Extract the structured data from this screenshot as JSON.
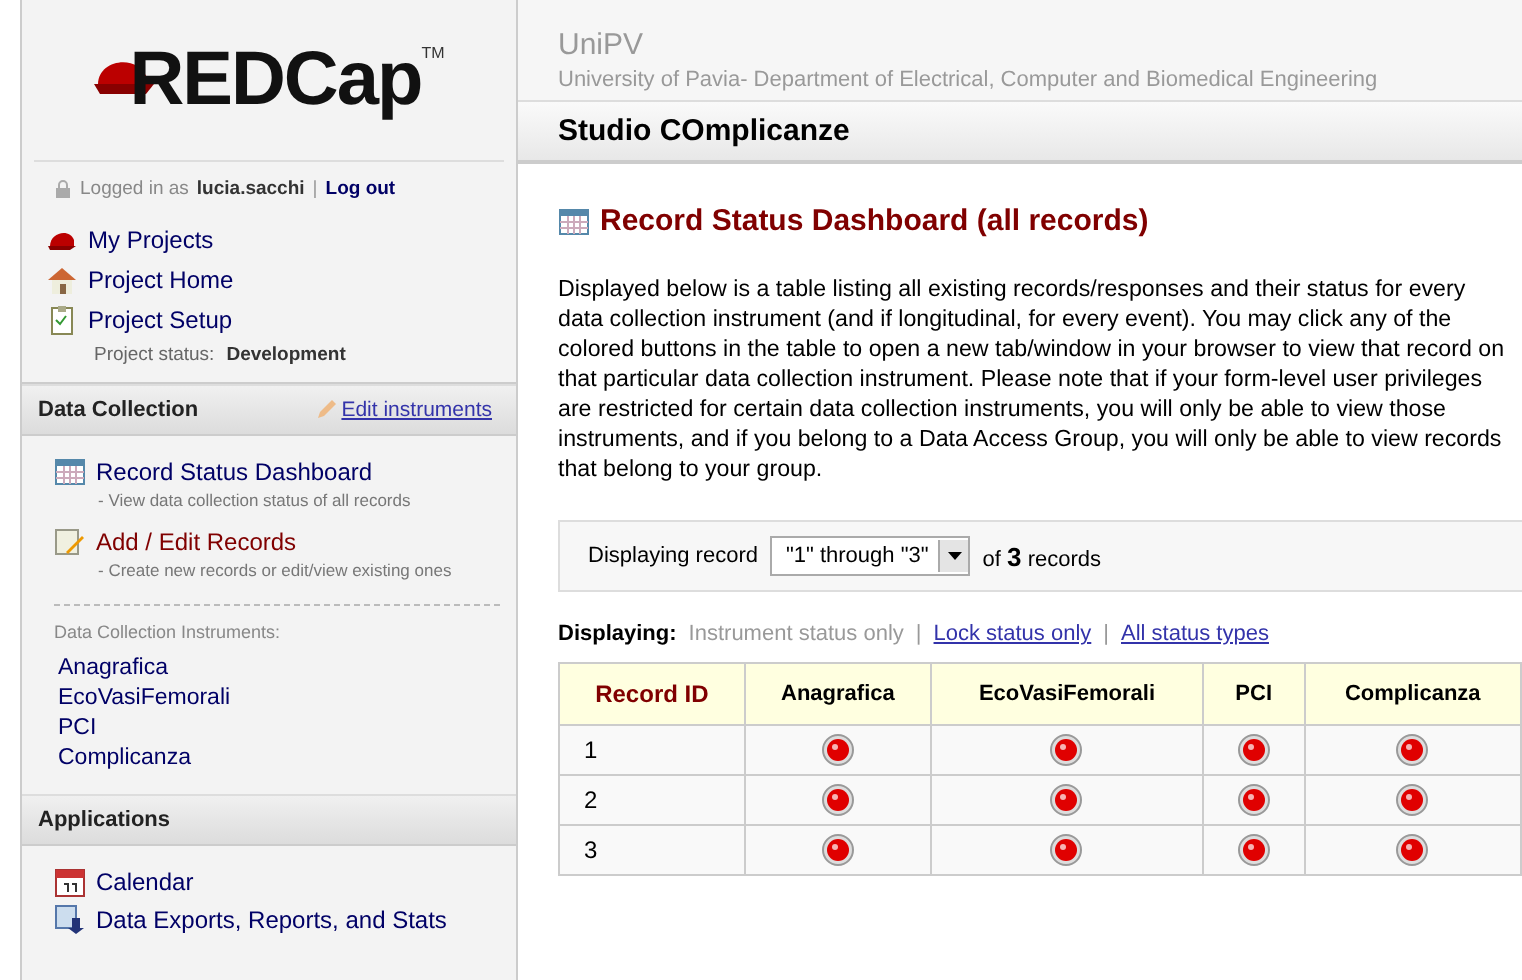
{
  "sidebar": {
    "logo": {
      "text": "REDCap",
      "mark": "TM"
    },
    "login": {
      "prefix": "Logged in as",
      "user": "lucia.sacchi",
      "separator": "|",
      "logout": "Log out"
    },
    "nav": [
      {
        "label": "My Projects"
      },
      {
        "label": "Project Home"
      },
      {
        "label": "Project Setup"
      }
    ],
    "project_status": {
      "label": "Project status:",
      "value": "Development"
    },
    "sections": [
      {
        "title": "Data Collection",
        "action": "Edit instruments",
        "items": [
          {
            "label": "Record Status Dashboard",
            "selected": false,
            "note": "- View data collection status of all records"
          },
          {
            "label": "Add / Edit Records",
            "selected": true,
            "note": "- Create new records or edit/view existing ones"
          }
        ],
        "instruments_label": "Data Collection Instruments:",
        "instruments": [
          "Anagrafica",
          "EcoVasiFemorali",
          "PCI",
          "Complicanza"
        ]
      },
      {
        "title": "Applications",
        "items": [
          {
            "label": "Calendar",
            "selected": false
          },
          {
            "label": "Data Exports, Reports, and Stats",
            "selected": false
          }
        ]
      }
    ]
  },
  "header": {
    "institution": "UniPV",
    "department": "University of Pavia- Department of Electrical, Computer and Biomedical Engineering",
    "project": "Studio COmplicanze"
  },
  "page": {
    "title": "Record Status Dashboard (all records)",
    "description": "Displayed below is a table listing all existing records/responses and their status for every data collection instrument (and if longitudinal, for every event). You may click any of the colored buttons in the table to open a new tab/window in your browser to view that record on that particular data collection instrument. Please note that if your form-level user privileges are restricted for certain data collection instruments, you will only be able to view those instruments, and if you belong to a Data Access Group, you will only be able to view records that belong to your group.",
    "record_picker": {
      "label": "Displaying record",
      "value": "\"1\" through \"3\"",
      "suffix_before": "of",
      "count": "3",
      "suffix_after": "records"
    },
    "display_modes": {
      "label": "Displaying:",
      "separator": "|",
      "options": [
        {
          "label": "Instrument status only",
          "selected": true
        },
        {
          "label": "Lock status only",
          "selected": false
        },
        {
          "label": "All status types",
          "selected": false
        }
      ]
    },
    "table": {
      "columns": [
        "Record ID",
        "Anagrafica",
        "EcoVasiFemorali",
        "PCI",
        "Complicanza"
      ],
      "rows": [
        {
          "id": "1",
          "cells": [
            {
              "color": "#e00000"
            },
            {
              "color": "#e00000"
            },
            {
              "color": "#e00000"
            },
            {
              "color": "#e00000"
            }
          ]
        },
        {
          "id": "2",
          "cells": [
            {
              "color": "#e00000"
            },
            {
              "color": "#e00000"
            },
            {
              "color": "#e00000"
            },
            {
              "color": "#e00000"
            }
          ]
        },
        {
          "id": "3",
          "cells": [
            {
              "color": "#e00000"
            },
            {
              "color": "#e00000"
            },
            {
              "color": "#e00000"
            },
            {
              "color": "#e00000"
            }
          ]
        }
      ]
    }
  }
}
